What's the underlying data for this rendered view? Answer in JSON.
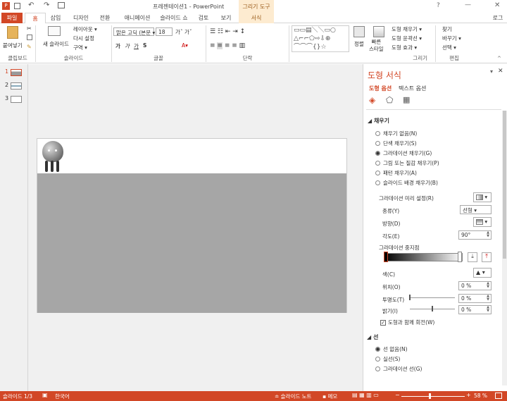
{
  "window": {
    "title": "프레젠테이션1 - PowerPoint",
    "context_tab": "그리기 도구",
    "user": "로그"
  },
  "tabs": [
    "파일",
    "홈",
    "삽입",
    "디자인",
    "전환",
    "애니메이션",
    "슬라이드 쇼",
    "검토",
    "보기",
    "서식"
  ],
  "ribbon": {
    "groups": [
      "클립보드",
      "슬라이드",
      "글꼴",
      "단락",
      "그리기",
      "편집"
    ],
    "paste": "붙여넣기",
    "new_slide": "새 슬라이드",
    "layout": "레이아웃 ▾",
    "reset": "다시 설정",
    "section": "구역 ▾",
    "font_name": "맑은 고딕 (본문 ▾",
    "font_size": "18",
    "arrange": "정렬",
    "quick_styles": "빠른\n스타일",
    "shape_fill": "도형 채우기 ▾",
    "shape_outline": "도형 윤곽선 ▾",
    "shape_effects": "도형 효과 ▾",
    "find": "찾기",
    "replace": "바꾸기 ▾",
    "select": "선택 ▾"
  },
  "thumbnails": [
    "1",
    "2",
    "3"
  ],
  "panel": {
    "title": "도형 서식",
    "tab_shape": "도형 옵션",
    "tab_text": "텍스트 옵션",
    "fill_section": "채우기",
    "fill_options": [
      {
        "label": "채우기 없음(N)",
        "checked": false
      },
      {
        "label": "단색 채우기(S)",
        "checked": false
      },
      {
        "label": "그라데이션 채우기(G)",
        "checked": true
      },
      {
        "label": "그림 또는 질감 채우기(P)",
        "checked": false
      },
      {
        "label": "패턴 채우기(A)",
        "checked": false
      },
      {
        "label": "슬라이드 배경 채우기(B)",
        "checked": false
      }
    ],
    "preset_label": "그라데이션 미리 설정(R)",
    "type_label": "종류(Y)",
    "type_value": "선형",
    "direction_label": "방향(D)",
    "angle_label": "각도(E)",
    "angle_value": "90°",
    "stops_label": "그라데이션 중지점",
    "color_label": "색(C)",
    "position_label": "위치(O)",
    "position_value": "0 %",
    "transparency_label": "투명도(T)",
    "transparency_value": "0 %",
    "brightness_label": "밝기(I)",
    "brightness_value": "0 %",
    "rotate_label": "도형과 함께 회전(W)",
    "line_section": "선",
    "line_options": [
      {
        "label": "선 없음(N)",
        "checked": true
      },
      {
        "label": "실선(S)",
        "checked": false
      },
      {
        "label": "그라데이션 선(G)",
        "checked": false
      }
    ]
  },
  "status": {
    "slide": "슬라이드 1/3",
    "language": "한국어",
    "notes": "슬라이드 노트",
    "comments": "메모",
    "zoom": "58 %"
  }
}
